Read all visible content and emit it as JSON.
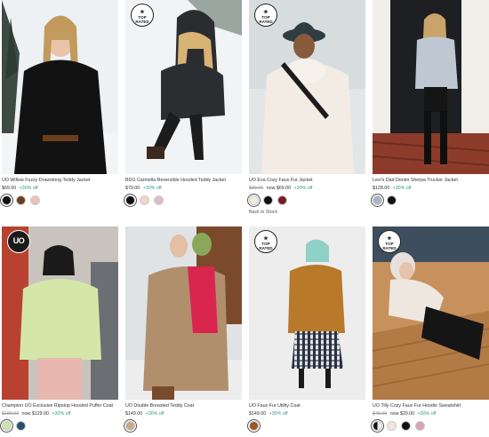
{
  "products": [
    {
      "name": "UO Willow Fuzzy Drawstring Teddy Jacket",
      "price_regular": "$69.00",
      "promo": "+30% off",
      "badge": "",
      "swatches": [
        "#111111",
        "#6b3f1e",
        "#e9c2b5"
      ],
      "note": ""
    },
    {
      "name": "BDG Carmella Reversible Hooded Teddy Jacket",
      "price_regular": "$79.00",
      "promo": "+30% off",
      "badge": "TOP RATED",
      "swatches": [
        "#111111",
        "#e8d9c8",
        "#d9bfc7"
      ],
      "note": ""
    },
    {
      "name": "UO Eva Cozy Faux Fur Jacket",
      "price_old": "$89.00",
      "price_now": "now $69.00",
      "promo": "+30% off",
      "badge": "TOP RATED",
      "swatches": [
        "#f3ede6",
        "#111111",
        "#7a1c24"
      ],
      "note": "Back in Stock"
    },
    {
      "name": "Levi's Dad Denim Sherpa Trucker Jacket",
      "price_regular": "$128.00",
      "promo": "+30% off",
      "badge": "",
      "swatches": [
        "#a9b6c7",
        "#111111"
      ],
      "note": ""
    },
    {
      "name": "Champion UO Exclusive Ripstop Hooded Puffer Coat",
      "price_old": "$189.00",
      "price_now": "now $129.00",
      "promo": "+30% off",
      "badge": "UO",
      "swatches": [
        "#cfe3a6",
        "#2b4c6b"
      ],
      "note": ""
    },
    {
      "name": "UO Double Breasted Teddy Coat",
      "price_regular": "$149.00",
      "promo": "+30% off",
      "badge": "",
      "swatches": [
        "#c9a88b"
      ],
      "note": ""
    },
    {
      "name": "UO Faux Fur Utility Coat",
      "price_regular": "$149.00",
      "promo": "+30% off",
      "badge": "TOP RATED",
      "swatches": [
        "#9a5a1f"
      ],
      "note": ""
    },
    {
      "name": "UO Tilly Cozy Faux Fur Hoodie Sweatshirt",
      "price_old": "$49.00",
      "price_now": "now $29.00",
      "promo": "+30% off",
      "badge": "TOP RATED",
      "swatches": [
        "half",
        "#efe6df",
        "#111111",
        "#d3a6b0"
      ],
      "note": ""
    }
  ],
  "badges": {
    "top_rated_1": "TOP",
    "top_rated_2": "RATED",
    "star": "★",
    "uo": "UO"
  },
  "colors": {
    "promo": "#2f9e87",
    "text": "#333333",
    "muted": "#999999"
  }
}
